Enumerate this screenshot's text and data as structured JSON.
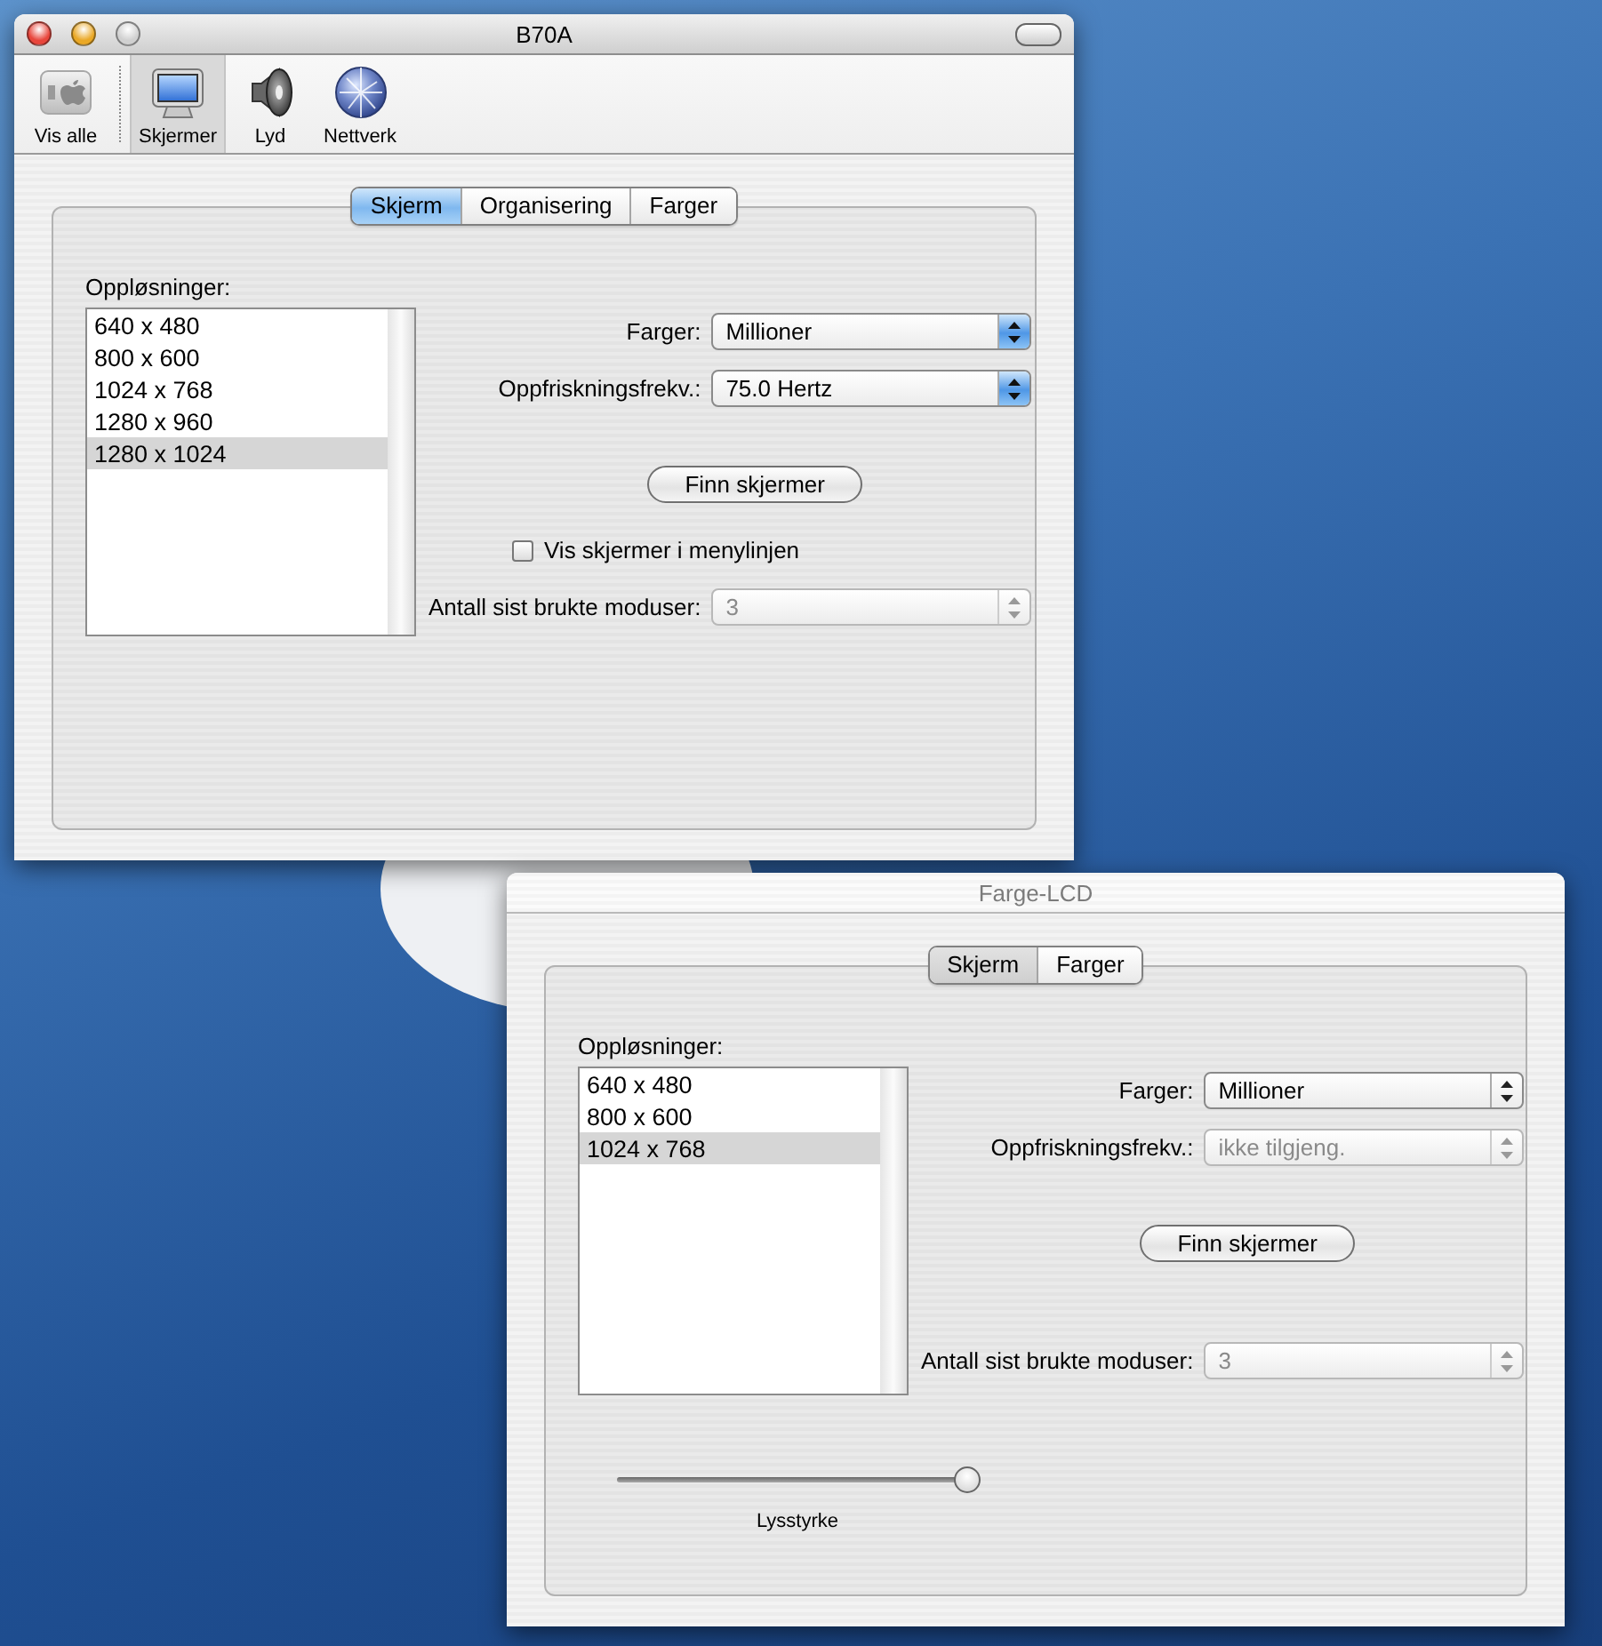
{
  "windows": [
    {
      "title": "B70A",
      "active": true,
      "title_buttons": true,
      "toolbar": [
        {
          "label": "Vis alle",
          "selected": false
        },
        {
          "label": "Skjermer",
          "selected": true
        },
        {
          "label": "Lyd",
          "selected": false
        },
        {
          "label": "Nettverk",
          "selected": false
        }
      ],
      "tabs": [
        {
          "label": "Skjerm",
          "selected": true
        },
        {
          "label": "Organisering",
          "selected": false
        },
        {
          "label": "Farger",
          "selected": false
        }
      ],
      "resolutions": {
        "label": "Oppløsninger:",
        "items": [
          {
            "text": "640 x 480",
            "selected": false
          },
          {
            "text": "800 x 600",
            "selected": false
          },
          {
            "text": "1024 x 768",
            "selected": false
          },
          {
            "text": "1280 x 960",
            "selected": false
          },
          {
            "text": "1280 x 1024",
            "selected": true
          }
        ]
      },
      "controls": [
        {
          "kind": "popup",
          "label": "Farger:",
          "value": "Millioner",
          "disabled": false
        },
        {
          "kind": "popup",
          "label": "Oppfriskningsfrekv.:",
          "value": "75.0 Hertz",
          "disabled": false
        },
        {
          "kind": "button",
          "label": "Finn skjermer"
        },
        {
          "kind": "checkbox",
          "label": "Vis skjermer i menylinjen",
          "checked": false
        },
        {
          "kind": "popup",
          "label": "Antall sist brukte moduser:",
          "value": "3",
          "disabled": true
        }
      ]
    },
    {
      "title": "Farge-LCD",
      "active": false,
      "title_buttons": false,
      "tabs": [
        {
          "label": "Skjerm",
          "selected": true
        },
        {
          "label": "Farger",
          "selected": false
        }
      ],
      "resolutions": {
        "label": "Oppløsninger:",
        "items": [
          {
            "text": "640 x 480",
            "selected": false
          },
          {
            "text": "800 x 600",
            "selected": false
          },
          {
            "text": "1024 x 768",
            "selected": true
          }
        ]
      },
      "controls": [
        {
          "kind": "popup",
          "label": "Farger:",
          "value": "Millioner",
          "disabled": false
        },
        {
          "kind": "popup",
          "label": "Oppfriskningsfrekv.:",
          "value": "ikke tilgjeng.",
          "disabled": true
        },
        {
          "kind": "button",
          "label": "Finn skjermer"
        },
        {
          "kind": "popup",
          "label": "Antall sist brukte moduser:",
          "value": "3",
          "disabled": true
        }
      ],
      "slider": {
        "label": "Lysstyrke",
        "level": 0.97
      }
    }
  ]
}
